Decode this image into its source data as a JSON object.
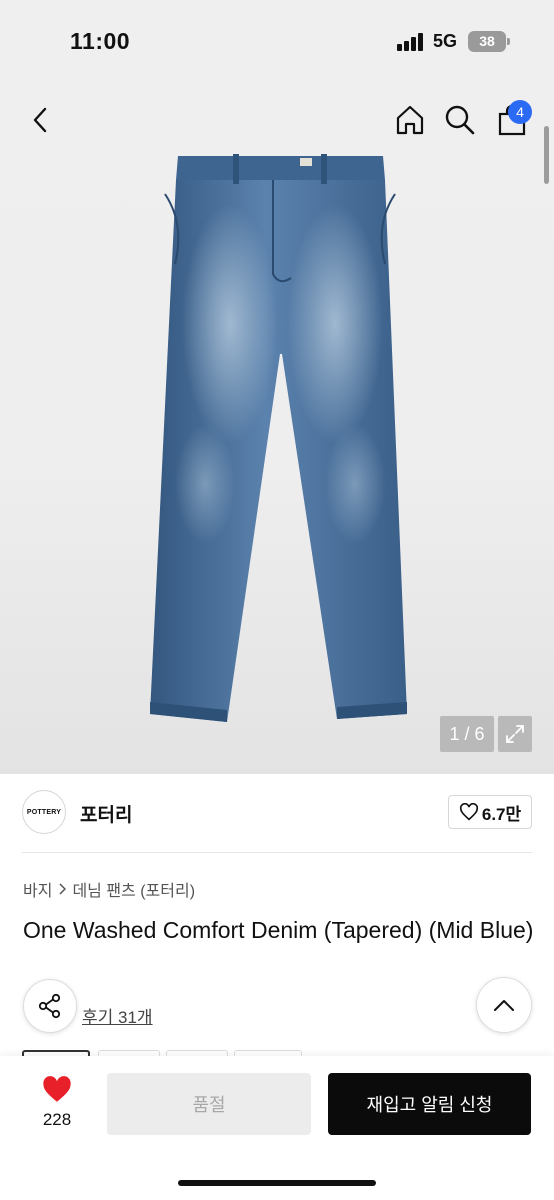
{
  "status_bar": {
    "time": "11:00",
    "network": "5G",
    "battery": "38"
  },
  "header": {
    "cart_count": "4"
  },
  "gallery": {
    "counter": "1 / 6"
  },
  "brand": {
    "logo_text": "POTTERY",
    "name": "포터리",
    "likes": "6.7만"
  },
  "breadcrumb": {
    "category": "바지",
    "subcategory": "데님 팬츠 (포터리)"
  },
  "product": {
    "title": "One Washed Comfort Denim (Tapered) (Mid Blue)",
    "reviews": "후기 31개"
  },
  "bottom_bar": {
    "wishlist_count": "228",
    "soldout_label": "품절",
    "restock_label": "재입고 알림 신청"
  },
  "colors": {
    "accent_badge": "#2b6bf3",
    "wishlist_heart": "#e8202a",
    "denim": "#4a6f9c"
  }
}
